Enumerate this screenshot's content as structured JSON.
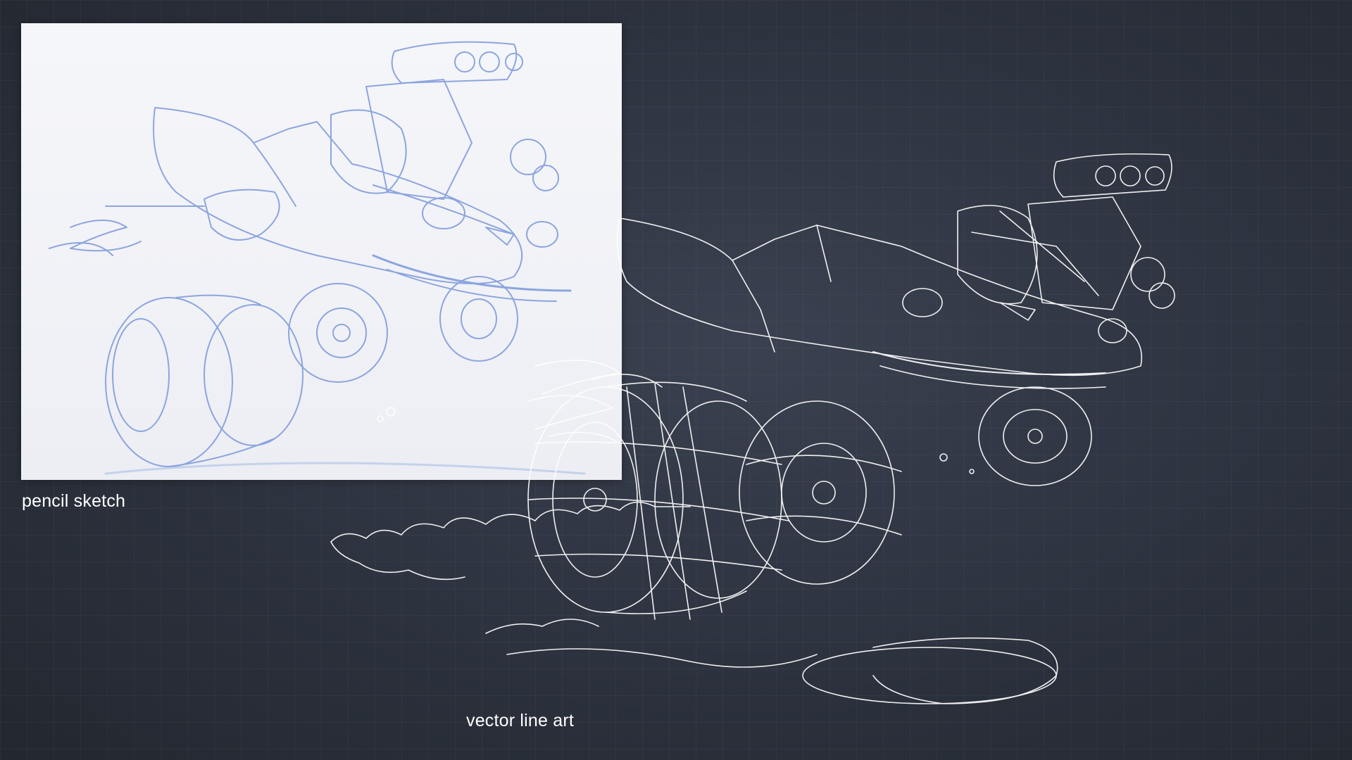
{
  "captions": {
    "pencil": "pencil sketch",
    "vector": "vector line art"
  },
  "colors": {
    "background": "#2c323e",
    "sketch_paper": "#f3f4f8",
    "pencil_line": "#6f8fd6",
    "vector_line": "#ffffff"
  }
}
